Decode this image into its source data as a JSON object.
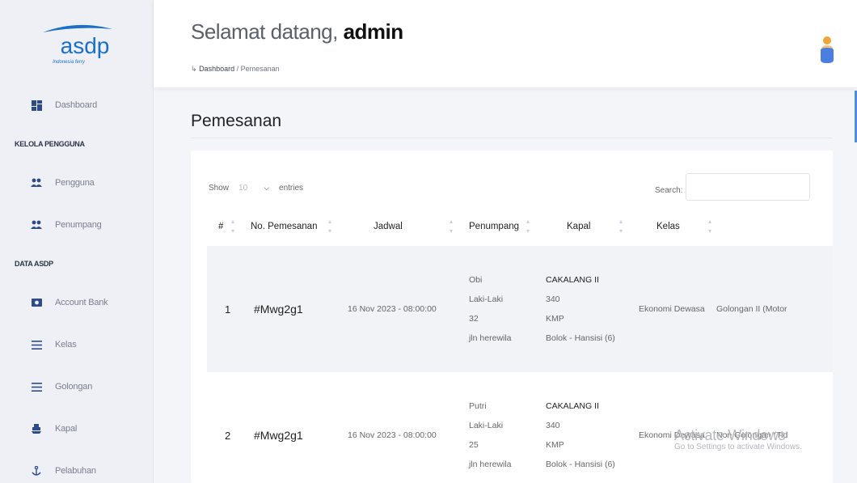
{
  "sidebar": {
    "logo_text": "asdp",
    "logo_tagline": "Indonesia ferry",
    "dashboard": "Dashboard",
    "section_users": "KELOLA PENGGUNA",
    "pengguna": "Pengguna",
    "penumpang": "Penumpang",
    "section_data": "DATA ASDP",
    "account_bank": "Account Bank",
    "kelas": "Kelas",
    "golongan": "Golongan",
    "kapal": "Kapal",
    "pelabuhan": "Pelabuhan"
  },
  "header": {
    "welcome": "Selamat datang,",
    "user": "admin",
    "breadcrumb_arrow": "↳",
    "breadcrumb_home": "Dashboard",
    "breadcrumb_sep": " / ",
    "breadcrumb_current": "Pemesanan"
  },
  "page": {
    "title": "Pemesanan"
  },
  "table_controls": {
    "show": "Show",
    "length_value": "10",
    "entries": "entries",
    "search_label": "Search:"
  },
  "table": {
    "columns": [
      "#",
      "No. Pemesanan",
      "Jadwal",
      "Penumpang",
      "Kapal",
      "Kelas"
    ],
    "rows": [
      {
        "no": "1",
        "kode": "#Mwg2g1",
        "jadwal": "16 Nov 2023 - 08:00:00",
        "penumpang": {
          "nama": "Obi",
          "jk": "Laki-Laki",
          "umur": "32",
          "alamat": "jln herewila"
        },
        "kapal": {
          "nama": "CAKALANG II",
          "kode": "340",
          "jenis": "KMP",
          "rute": "Bolok - Hansisi (6)"
        },
        "kelas": "Ekonomi Dewasa",
        "golongan": "Golongan II (Motor"
      },
      {
        "no": "2",
        "kode": "#Mwg2g1",
        "jadwal": "16 Nov 2023 - 08:00:00",
        "penumpang": {
          "nama": "Putri",
          "jk": "Laki-Laki",
          "umur": "25",
          "alamat": "jln herewila"
        },
        "kapal": {
          "nama": "CAKALANG II",
          "kode": "340",
          "jenis": "KMP",
          "rute": "Bolok - Hansisi (6)"
        },
        "kelas": "Ekonomi Dewasa",
        "golongan": "Non Golongan (Tid"
      }
    ]
  },
  "watermark": {
    "line1": "Activate Windows",
    "line2": "Go to Settings to activate Windows."
  },
  "colors": {
    "brand_blue": "#1a6fc9",
    "icon_navy": "#2d4a8a",
    "avatar_orange": "#f0a53a",
    "avatar_blue": "#4a7ee0"
  }
}
